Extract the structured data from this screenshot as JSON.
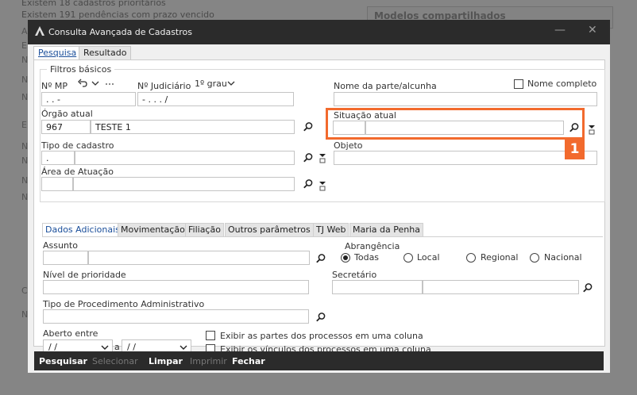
{
  "background": {
    "line1": "Existem 18 cadastros prioritários",
    "line2": "Existem 191 pendências com prazo vencido",
    "panel_title": "Modelos compartilhados",
    "letters": [
      "A",
      "E",
      "N",
      "N",
      "N",
      "E",
      "N",
      "N",
      "N",
      "N",
      "C",
      "N"
    ]
  },
  "window": {
    "title": "Consulta Avançada de Cadastros",
    "minimize": "—",
    "close": "✕"
  },
  "tabs": [
    {
      "label": "Pesquisa"
    },
    {
      "label": "Resultado"
    }
  ],
  "filtros": {
    "legend": "Filtros básicos",
    "n_mp_label": "Nº MP",
    "n_mp_value": ".    .       -",
    "n_judiciario_label": "Nº Judiciário",
    "grau_label": "1º grau",
    "n_judiciario_value": "-    .    .    .       /",
    "nome_label": "Nome da parte/alcunha",
    "nome_value": "",
    "nome_completo_label": "Nome completo",
    "orgao_label": "Órgão atual",
    "orgao_code": "967",
    "orgao_name": "TESTE 1",
    "situacao_label": "Situação atual",
    "situacao_code": "",
    "situacao_name": "",
    "tipo_label": "Tipo de cadastro",
    "tipo_code": ".",
    "tipo_name": "",
    "objeto_label": "Objeto",
    "objeto_value": "",
    "area_label": "Área de Atuação",
    "area_code": "",
    "area_name": ""
  },
  "subtabs": [
    {
      "label": "Dados Adicionais"
    },
    {
      "label": "Movimentação"
    },
    {
      "label": "Filiação"
    },
    {
      "label": "Outros parâmetros"
    },
    {
      "label": "TJ Web"
    },
    {
      "label": "Maria da Penha"
    }
  ],
  "adicionais": {
    "assunto_label": "Assunto",
    "abrangencia_label": "Abrangência",
    "radio_todas": "Todas",
    "radio_local": "Local",
    "radio_regional": "Regional",
    "radio_nacional": "Nacional",
    "prioridade_label": "Nível de prioridade",
    "secretario_label": "Secretário",
    "procedimento_label": "Tipo de Procedimento Administrativo",
    "aberto_label": "Aberto entre",
    "date_from": " / /",
    "date_sep": "a",
    "date_to": " / /",
    "check_partes": "Exibir as partes dos processos em uma coluna",
    "check_vinculos": "Exibir os vínculos dos processos em uma coluna"
  },
  "footer": {
    "pesquisar": "Pesquisar",
    "selecionar": "Selecionar",
    "limpar": "Limpar",
    "imprimir": "Imprimir",
    "fechar": "Fechar"
  },
  "annotation": {
    "badge": "1",
    "color": "#f26a2d"
  }
}
